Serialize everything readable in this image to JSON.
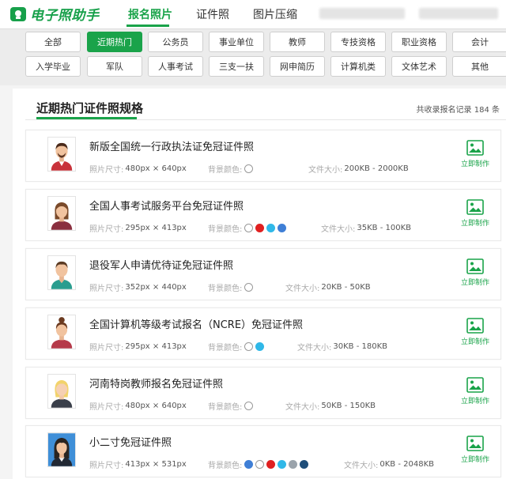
{
  "header": {
    "logo_text": "电子照助手",
    "nav": [
      {
        "label": "报名照片",
        "active": true
      },
      {
        "label": "证件照",
        "active": false
      },
      {
        "label": "图片压缩",
        "active": false
      }
    ]
  },
  "categories": {
    "row1": [
      "全部",
      "近期热门",
      "公务员",
      "事业单位",
      "教师",
      "专技资格",
      "职业资格",
      "会计"
    ],
    "row2": [
      "入学毕业",
      "军队",
      "人事考试",
      "三支一扶",
      "网申简历",
      "计算机类",
      "文体艺术",
      "其他"
    ],
    "active": "近期热门"
  },
  "section": {
    "title": "近期热门证件照规格",
    "record_count": "共收录报名记录 184 条"
  },
  "labels": {
    "size": "照片尺寸:",
    "bg": "背景颜色:",
    "file": "文件大小:",
    "action": "立即制作"
  },
  "items": [
    {
      "title": "新版全国统一行政执法证免冠证件照",
      "size": "480px × 640px",
      "file_size": "200KB - 2000KB",
      "bg_colors": [
        "#ffffff"
      ],
      "avatar": "man-red-shirt"
    },
    {
      "title": "全国人事考试服务平台免冠证件照",
      "size": "295px × 413px",
      "file_size": "35KB - 100KB",
      "bg_colors": [
        "#ffffff",
        "#e02020",
        "#30b8e8",
        "#3f7fd6"
      ],
      "avatar": "woman-brown-hair"
    },
    {
      "title": "退役军人申请优待证免冠证件照",
      "size": "352px × 440px",
      "file_size": "20KB - 50KB",
      "bg_colors": [
        "#ffffff"
      ],
      "avatar": "man-teal-shirt"
    },
    {
      "title": "全国计算机等级考试报名（NCRE）免冠证件照",
      "size": "295px × 413px",
      "file_size": "30KB - 180KB",
      "bg_colors": [
        "#ffffff",
        "#30b8e8"
      ],
      "avatar": "woman-bun-hair"
    },
    {
      "title": "河南特岗教师报名免冠证件照",
      "size": "480px × 640px",
      "file_size": "50KB - 150KB",
      "bg_colors": [
        "#ffffff"
      ],
      "avatar": "woman-blonde"
    },
    {
      "title": "小二寸免冠证件照",
      "size": "413px × 531px",
      "file_size": "0KB - 2048KB",
      "bg_colors": [
        "#3f7fd6",
        "#ffffff",
        "#e02020",
        "#30b8e8",
        "#9aa3ab",
        "#1f4e79"
      ],
      "avatar": "woman-dark-hair-blue-bg"
    }
  ],
  "colors": {
    "accent": "#1aa34a"
  }
}
